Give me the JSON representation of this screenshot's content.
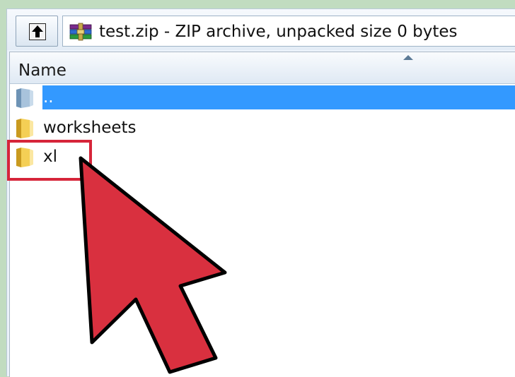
{
  "toolbar": {
    "up_button_icon": "up-one-level-icon",
    "archive_icon": "winrar-archive-icon",
    "path_text": "test.zip - ZIP archive, unpacked size 0 bytes"
  },
  "file_list": {
    "column_header": "Name",
    "sort_icon": "sort-ascending-icon",
    "rows": [
      {
        "name": "..",
        "icon": "parent-folder-icon",
        "selected": true
      },
      {
        "name": "worksheets",
        "icon": "folder-icon",
        "selected": false
      },
      {
        "name": "xl",
        "icon": "folder-icon",
        "selected": false
      }
    ]
  },
  "annotations": {
    "highlight_color": "#d6253a",
    "arrow_color": "#d9303f"
  },
  "colors": {
    "background": "#c1dcc0",
    "selection": "#3399ff"
  }
}
